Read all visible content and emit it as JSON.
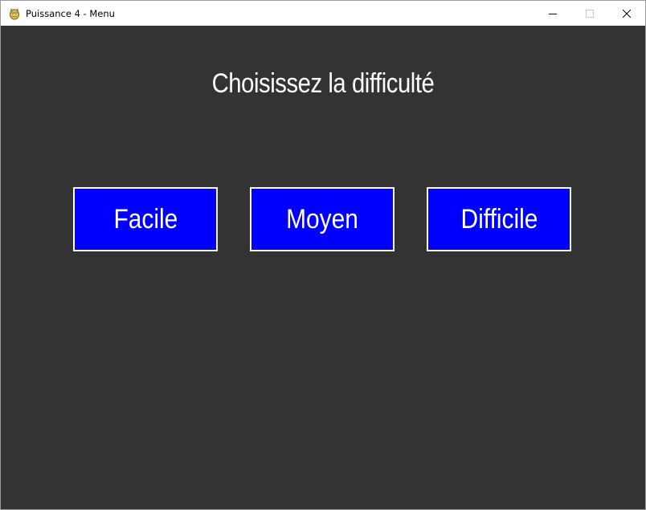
{
  "window": {
    "title": "Puissance 4 - Menu",
    "icon": "pygame-snake-icon"
  },
  "titlebar_controls": {
    "minimize_icon": "minimize-icon",
    "maximize_icon": "maximize-icon",
    "close_icon": "close-icon"
  },
  "menu": {
    "heading": "Choisissez la difficulté",
    "buttons": [
      {
        "label": "Facile"
      },
      {
        "label": "Moyen"
      },
      {
        "label": "Difficile"
      }
    ]
  },
  "colors": {
    "background": "#333333",
    "button_fill": "#0000ff",
    "button_border": "#ffffff",
    "text": "#ffffff"
  }
}
